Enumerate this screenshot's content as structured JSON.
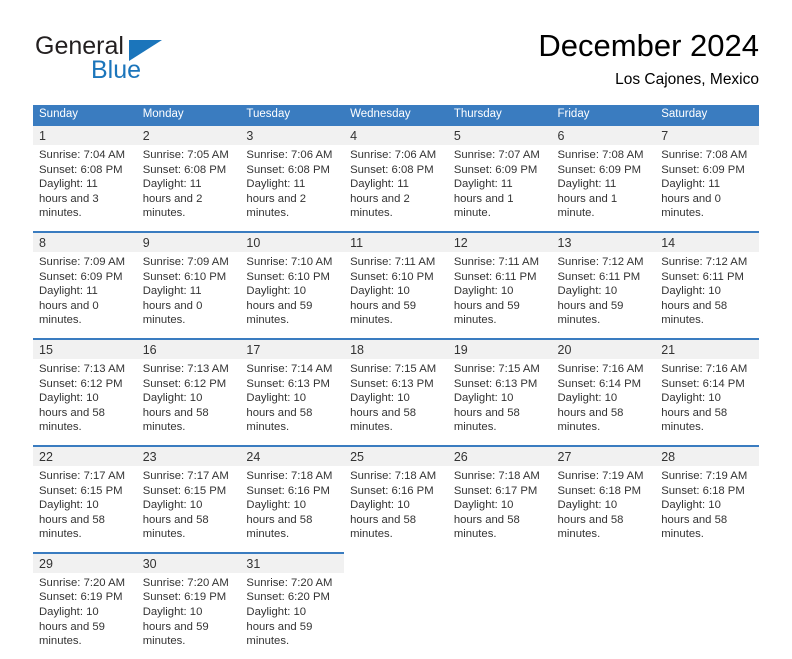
{
  "brand": {
    "word_one": "General",
    "word_two": "Blue",
    "triangle_icon": "brand-triangle-icon",
    "accent_color": "#1b75bb"
  },
  "header": {
    "title": "December 2024",
    "subtitle": "Los Cajones, Mexico"
  },
  "calendar": {
    "header_color": "#3a7cc0",
    "daynum_bg": "#f1f1f1",
    "weekday_labels": [
      "Sunday",
      "Monday",
      "Tuesday",
      "Wednesday",
      "Thursday",
      "Friday",
      "Saturday"
    ],
    "weeks": [
      [
        {
          "day": "1",
          "sunrise": "Sunrise: 7:04 AM",
          "sunset": "Sunset: 6:08 PM",
          "daylight": "Daylight: 11 hours and 3 minutes."
        },
        {
          "day": "2",
          "sunrise": "Sunrise: 7:05 AM",
          "sunset": "Sunset: 6:08 PM",
          "daylight": "Daylight: 11 hours and 2 minutes."
        },
        {
          "day": "3",
          "sunrise": "Sunrise: 7:06 AM",
          "sunset": "Sunset: 6:08 PM",
          "daylight": "Daylight: 11 hours and 2 minutes."
        },
        {
          "day": "4",
          "sunrise": "Sunrise: 7:06 AM",
          "sunset": "Sunset: 6:08 PM",
          "daylight": "Daylight: 11 hours and 2 minutes."
        },
        {
          "day": "5",
          "sunrise": "Sunrise: 7:07 AM",
          "sunset": "Sunset: 6:09 PM",
          "daylight": "Daylight: 11 hours and 1 minute."
        },
        {
          "day": "6",
          "sunrise": "Sunrise: 7:08 AM",
          "sunset": "Sunset: 6:09 PM",
          "daylight": "Daylight: 11 hours and 1 minute."
        },
        {
          "day": "7",
          "sunrise": "Sunrise: 7:08 AM",
          "sunset": "Sunset: 6:09 PM",
          "daylight": "Daylight: 11 hours and 0 minutes."
        }
      ],
      [
        {
          "day": "8",
          "sunrise": "Sunrise: 7:09 AM",
          "sunset": "Sunset: 6:09 PM",
          "daylight": "Daylight: 11 hours and 0 minutes."
        },
        {
          "day": "9",
          "sunrise": "Sunrise: 7:09 AM",
          "sunset": "Sunset: 6:10 PM",
          "daylight": "Daylight: 11 hours and 0 minutes."
        },
        {
          "day": "10",
          "sunrise": "Sunrise: 7:10 AM",
          "sunset": "Sunset: 6:10 PM",
          "daylight": "Daylight: 10 hours and 59 minutes."
        },
        {
          "day": "11",
          "sunrise": "Sunrise: 7:11 AM",
          "sunset": "Sunset: 6:10 PM",
          "daylight": "Daylight: 10 hours and 59 minutes."
        },
        {
          "day": "12",
          "sunrise": "Sunrise: 7:11 AM",
          "sunset": "Sunset: 6:11 PM",
          "daylight": "Daylight: 10 hours and 59 minutes."
        },
        {
          "day": "13",
          "sunrise": "Sunrise: 7:12 AM",
          "sunset": "Sunset: 6:11 PM",
          "daylight": "Daylight: 10 hours and 59 minutes."
        },
        {
          "day": "14",
          "sunrise": "Sunrise: 7:12 AM",
          "sunset": "Sunset: 6:11 PM",
          "daylight": "Daylight: 10 hours and 58 minutes."
        }
      ],
      [
        {
          "day": "15",
          "sunrise": "Sunrise: 7:13 AM",
          "sunset": "Sunset: 6:12 PM",
          "daylight": "Daylight: 10 hours and 58 minutes."
        },
        {
          "day": "16",
          "sunrise": "Sunrise: 7:13 AM",
          "sunset": "Sunset: 6:12 PM",
          "daylight": "Daylight: 10 hours and 58 minutes."
        },
        {
          "day": "17",
          "sunrise": "Sunrise: 7:14 AM",
          "sunset": "Sunset: 6:13 PM",
          "daylight": "Daylight: 10 hours and 58 minutes."
        },
        {
          "day": "18",
          "sunrise": "Sunrise: 7:15 AM",
          "sunset": "Sunset: 6:13 PM",
          "daylight": "Daylight: 10 hours and 58 minutes."
        },
        {
          "day": "19",
          "sunrise": "Sunrise: 7:15 AM",
          "sunset": "Sunset: 6:13 PM",
          "daylight": "Daylight: 10 hours and 58 minutes."
        },
        {
          "day": "20",
          "sunrise": "Sunrise: 7:16 AM",
          "sunset": "Sunset: 6:14 PM",
          "daylight": "Daylight: 10 hours and 58 minutes."
        },
        {
          "day": "21",
          "sunrise": "Sunrise: 7:16 AM",
          "sunset": "Sunset: 6:14 PM",
          "daylight": "Daylight: 10 hours and 58 minutes."
        }
      ],
      [
        {
          "day": "22",
          "sunrise": "Sunrise: 7:17 AM",
          "sunset": "Sunset: 6:15 PM",
          "daylight": "Daylight: 10 hours and 58 minutes."
        },
        {
          "day": "23",
          "sunrise": "Sunrise: 7:17 AM",
          "sunset": "Sunset: 6:15 PM",
          "daylight": "Daylight: 10 hours and 58 minutes."
        },
        {
          "day": "24",
          "sunrise": "Sunrise: 7:18 AM",
          "sunset": "Sunset: 6:16 PM",
          "daylight": "Daylight: 10 hours and 58 minutes."
        },
        {
          "day": "25",
          "sunrise": "Sunrise: 7:18 AM",
          "sunset": "Sunset: 6:16 PM",
          "daylight": "Daylight: 10 hours and 58 minutes."
        },
        {
          "day": "26",
          "sunrise": "Sunrise: 7:18 AM",
          "sunset": "Sunset: 6:17 PM",
          "daylight": "Daylight: 10 hours and 58 minutes."
        },
        {
          "day": "27",
          "sunrise": "Sunrise: 7:19 AM",
          "sunset": "Sunset: 6:18 PM",
          "daylight": "Daylight: 10 hours and 58 minutes."
        },
        {
          "day": "28",
          "sunrise": "Sunrise: 7:19 AM",
          "sunset": "Sunset: 6:18 PM",
          "daylight": "Daylight: 10 hours and 58 minutes."
        }
      ],
      [
        {
          "day": "29",
          "sunrise": "Sunrise: 7:20 AM",
          "sunset": "Sunset: 6:19 PM",
          "daylight": "Daylight: 10 hours and 59 minutes."
        },
        {
          "day": "30",
          "sunrise": "Sunrise: 7:20 AM",
          "sunset": "Sunset: 6:19 PM",
          "daylight": "Daylight: 10 hours and 59 minutes."
        },
        {
          "day": "31",
          "sunrise": "Sunrise: 7:20 AM",
          "sunset": "Sunset: 6:20 PM",
          "daylight": "Daylight: 10 hours and 59 minutes."
        },
        {
          "day": "",
          "sunrise": "",
          "sunset": "",
          "daylight": ""
        },
        {
          "day": "",
          "sunrise": "",
          "sunset": "",
          "daylight": ""
        },
        {
          "day": "",
          "sunrise": "",
          "sunset": "",
          "daylight": ""
        },
        {
          "day": "",
          "sunrise": "",
          "sunset": "",
          "daylight": ""
        }
      ]
    ]
  }
}
